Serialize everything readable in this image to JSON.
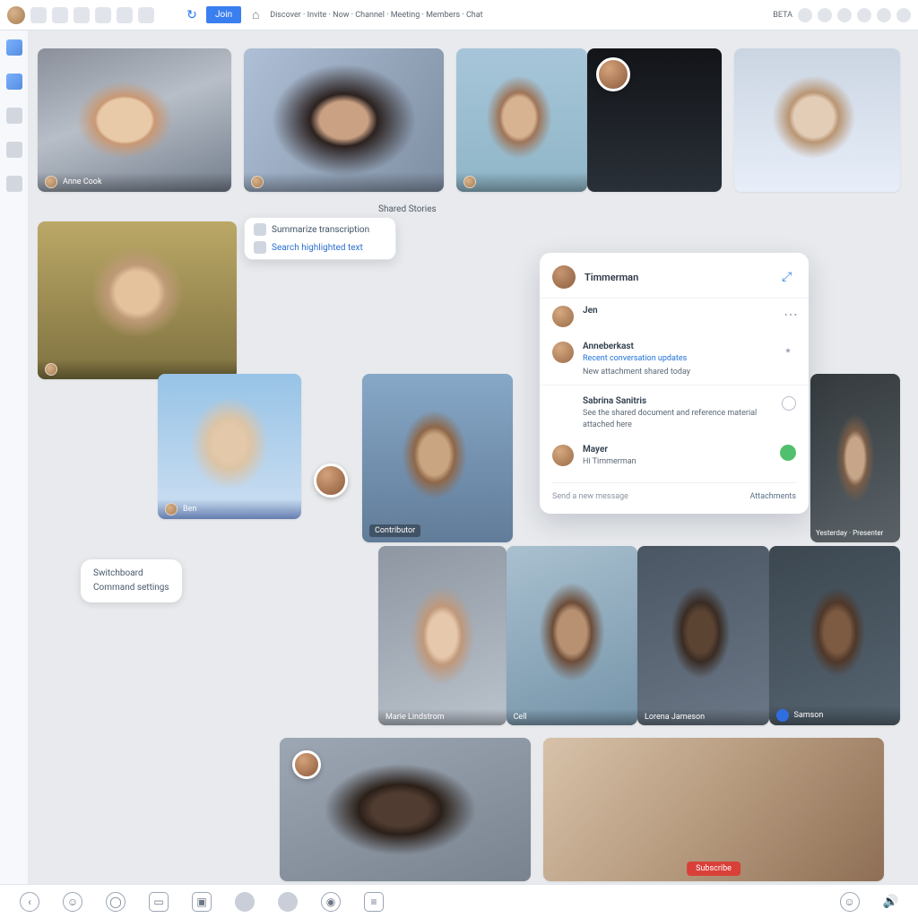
{
  "topbar": {
    "active_tab": "Join",
    "breadcrumb": "Discover · Invite · Now · Channel · Meeting · Members · Chat",
    "right_label": "BETA"
  },
  "sections": {
    "middle_label": "Shared Stories"
  },
  "tiles": {
    "r1": [
      {
        "name": "Anne Cook"
      },
      {
        "name": ""
      },
      {
        "name": ""
      },
      {
        "name": ""
      },
      {
        "name": ""
      }
    ],
    "r2": [
      {
        "name": ""
      }
    ],
    "r3": [
      {
        "name": "Ben"
      },
      {
        "name": "Contributor"
      }
    ],
    "r4": [
      {
        "name": "Marie Lindstrom"
      },
      {
        "name": "Cell"
      },
      {
        "name": "Lorena Jameson"
      },
      {
        "name": "Samson"
      }
    ],
    "r5": [
      {
        "name": ""
      },
      {
        "name": "",
        "cta": "Subscribe"
      }
    ]
  },
  "tooltip_top": {
    "line1": "Summarize transcription",
    "line2": "Search highlighted text"
  },
  "tooltip_left": {
    "line1": "Switchboard",
    "line2": "Command settings"
  },
  "p8_overlay": "Contributor",
  "r4_tag": "Yesterday · Presenter",
  "chat": {
    "title": "Timmerman",
    "rows": [
      {
        "name": "Jen",
        "text": ""
      },
      {
        "name": "Anneberkast",
        "text": "Recent conversation updates",
        "sub": "New attachment shared today"
      },
      {
        "name": "Sabrina Sanitris",
        "text": "See the shared document and reference material attached here"
      },
      {
        "name": "Mayer",
        "text": "Hi Timmerman"
      }
    ],
    "placeholder": "Send a new message",
    "footer_link": "Attachments"
  },
  "dock": {
    "icons": [
      "back",
      "chat",
      "shield",
      "video",
      "screen",
      "person",
      "face",
      "camera",
      "list"
    ]
  }
}
